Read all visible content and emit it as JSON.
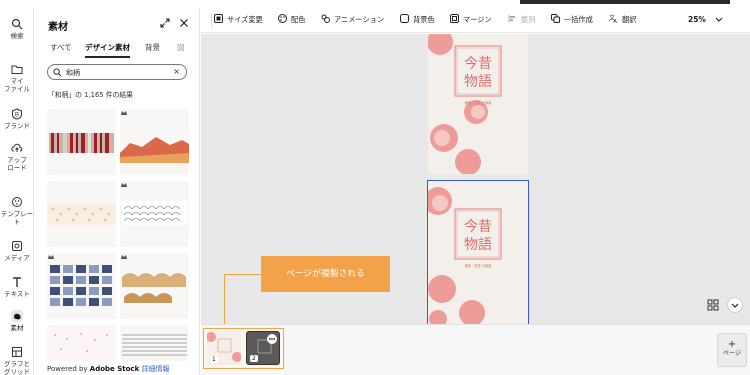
{
  "rail": {
    "items": [
      {
        "label": "検索",
        "icon": "search-icon"
      },
      {
        "label": "マイ\nファイル",
        "icon": "folder-icon"
      },
      {
        "label": "ブランド",
        "icon": "brand-icon"
      },
      {
        "label": "アップ\nロード",
        "icon": "upload-icon"
      },
      {
        "label": "テンプレー\nト",
        "icon": "template-icon"
      },
      {
        "label": "メディア",
        "icon": "media-icon"
      },
      {
        "label": "テキスト",
        "icon": "text-icon"
      },
      {
        "label": "素材",
        "icon": "elements-icon"
      },
      {
        "label": "グラフと\nグリッド",
        "icon": "chart-grid-icon"
      }
    ]
  },
  "panel": {
    "title": "素材",
    "tabs": [
      "すべて",
      "デザイン素材",
      "背景",
      "図"
    ],
    "search": {
      "value": "和柄",
      "clear": "×"
    },
    "results": "「和柄」の 1,165 件の結果",
    "powered": {
      "prefix": "Powered by ",
      "brand": "Adobe Stock",
      "link": "詳細情報"
    }
  },
  "toolbar": {
    "items": [
      {
        "label": "サイズ変更",
        "icon": "resize-icon"
      },
      {
        "label": "配色",
        "icon": "palette-icon"
      },
      {
        "label": "アニメーション",
        "icon": "animation-icon"
      },
      {
        "label": "背景色",
        "icon": "background-color-icon"
      },
      {
        "label": "マージン",
        "icon": "margin-icon"
      },
      {
        "label": "整列",
        "icon": "align-icon"
      },
      {
        "label": "一括作成",
        "icon": "bulk-create-icon"
      },
      {
        "label": "翻訳",
        "icon": "translate-icon"
      }
    ],
    "zoom": "25%"
  },
  "canvas": {
    "page_text_line1": "今昔",
    "page_text_line2": "物語",
    "page_subtext": "著者・監督 出演者"
  },
  "callout": {
    "text": "ページが複製される"
  },
  "strip": {
    "pages": [
      "1",
      "2"
    ],
    "add_page": {
      "plus": "+",
      "label": "ページ"
    }
  },
  "colors": {
    "accent_orange": "#f4a24a",
    "selection_blue": "#3a57d6",
    "pattern_pink": "#e89a94"
  }
}
